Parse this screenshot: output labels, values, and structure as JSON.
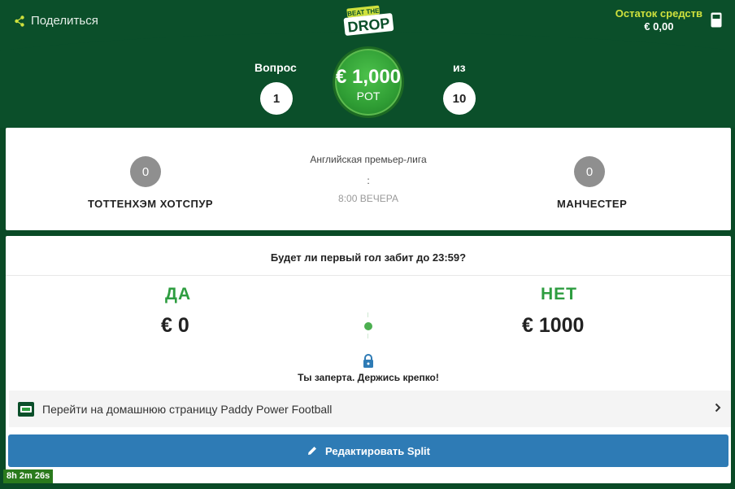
{
  "header": {
    "share_label": "Поделиться",
    "balance_label": "Остаток средств",
    "balance_value": "€ 0,00",
    "logo_top": "BEAT THE",
    "logo_bottom": "DROP",
    "question_label": "Вопрос",
    "question_number": "1",
    "of_label": "из",
    "total_questions": "10",
    "pot_amount": "€ 1,000",
    "pot_label": "POT"
  },
  "match": {
    "home_score": "0",
    "home_team": "ТОТТЕНХЭМ ХОТСПУР",
    "away_score": "0",
    "away_team": "МАНЧЕСТЕР",
    "league": "Английская премьер-лига",
    "separator": ":",
    "kickoff": "8:00 ВЕЧЕРА"
  },
  "question": {
    "text": "Будет ли первый гол забит до 23:59?",
    "yes_label": "ДА",
    "yes_value": "€ 0",
    "no_label": "НЕТ",
    "no_value": "€ 1000",
    "locked_text": "Ты заперта. Держись крепко!"
  },
  "link": {
    "text": "Перейти на домашнюю страницу Paddy Power Football"
  },
  "edit_button": {
    "label": "Редактировать Split"
  },
  "timer": "8h 2m 26s",
  "colors": {
    "accent_green": "#2e9d40",
    "button_blue": "#2e7bb5",
    "balance_yellow": "#cfe13d",
    "header_green": "#0b4f2a"
  },
  "icons": [
    "share-icon",
    "logo-icon",
    "wallet-icon",
    "lock-icon",
    "paddy-power-icon",
    "chevron-right-icon",
    "pencil-icon"
  ]
}
